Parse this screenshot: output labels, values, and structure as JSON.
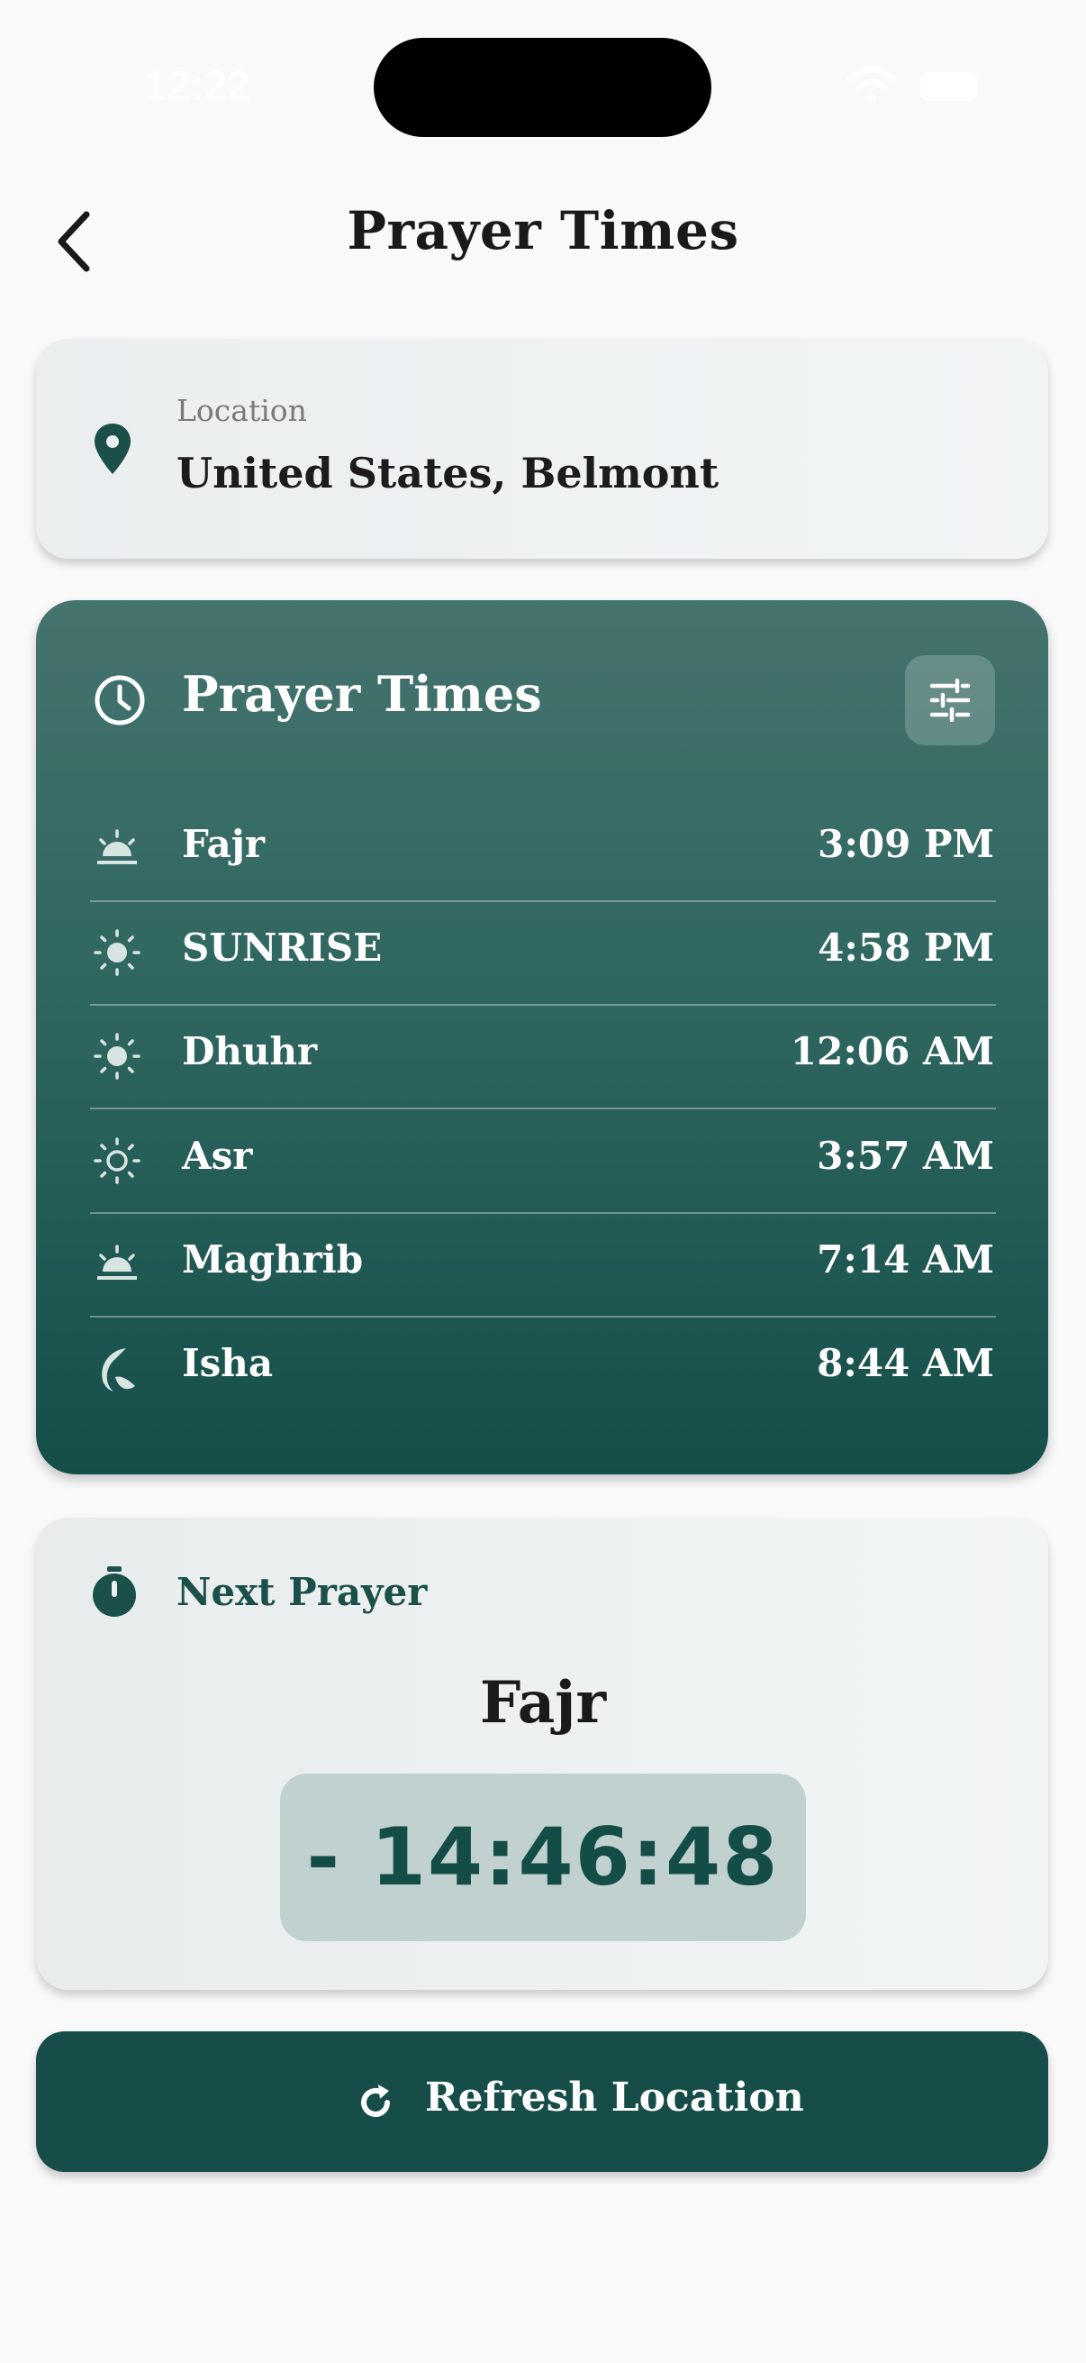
{
  "status_bar": {
    "time": "12:22"
  },
  "header": {
    "title": "Prayer Times"
  },
  "location": {
    "label": "Location",
    "value": "United States, Belmont"
  },
  "prayer_times": {
    "title": "Prayer Times",
    "rows": [
      {
        "name": "Fajr",
        "time": "3:09 PM",
        "icon": "sunrise-half-icon"
      },
      {
        "name": "SUNRISE",
        "time": "4:58 PM",
        "icon": "sun-filled-icon"
      },
      {
        "name": "Dhuhr",
        "time": "12:06 AM",
        "icon": "sun-filled-icon"
      },
      {
        "name": "Asr",
        "time": "3:57 AM",
        "icon": "sun-outline-icon"
      },
      {
        "name": "Maghrib",
        "time": "7:14 AM",
        "icon": "sunset-half-icon"
      },
      {
        "name": "Isha",
        "time": "8:44 AM",
        "icon": "moon-icon"
      }
    ]
  },
  "next_prayer": {
    "label": "Next Prayer",
    "name": "Fajr",
    "countdown": "- 14:46:48"
  },
  "refresh": {
    "label": "Refresh Location"
  },
  "colors": {
    "primary": "#164d48",
    "card_light": "#eef1f2",
    "timer_bg": "#c1d1cf"
  }
}
